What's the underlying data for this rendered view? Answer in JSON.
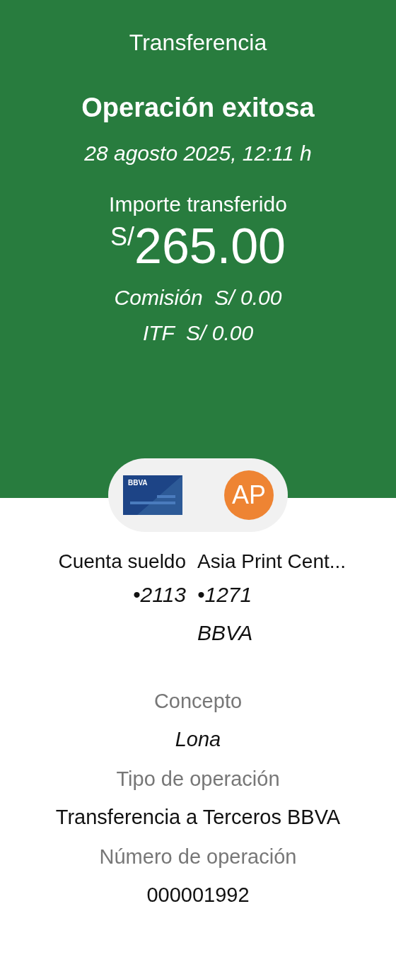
{
  "header": {
    "title": "Transferencia",
    "status": "Operación exitosa",
    "datetime": "28 agosto 2025, 12:11 h",
    "amount_label": "Importe transferido",
    "currency": "S/",
    "amount": "265.00",
    "fees": [
      "Comisión  S/ 0.00",
      "ITF  S/ 0.00"
    ]
  },
  "parties": {
    "card_logo": "BBVA",
    "avatar_initials": "AP",
    "origin": {
      "name": "Cuenta sueldo",
      "account": "•2113"
    },
    "destination": {
      "name": "Asia Print Cent...",
      "account": "•1271",
      "bank": "BBVA"
    }
  },
  "details": [
    {
      "label": "Concepto",
      "value": "Lona",
      "italic": true
    },
    {
      "label": "Tipo de operación",
      "value": "Transferencia a Terceros BBVA",
      "italic": false
    },
    {
      "label": "Número de operación",
      "value": "000001992",
      "italic": false
    }
  ]
}
